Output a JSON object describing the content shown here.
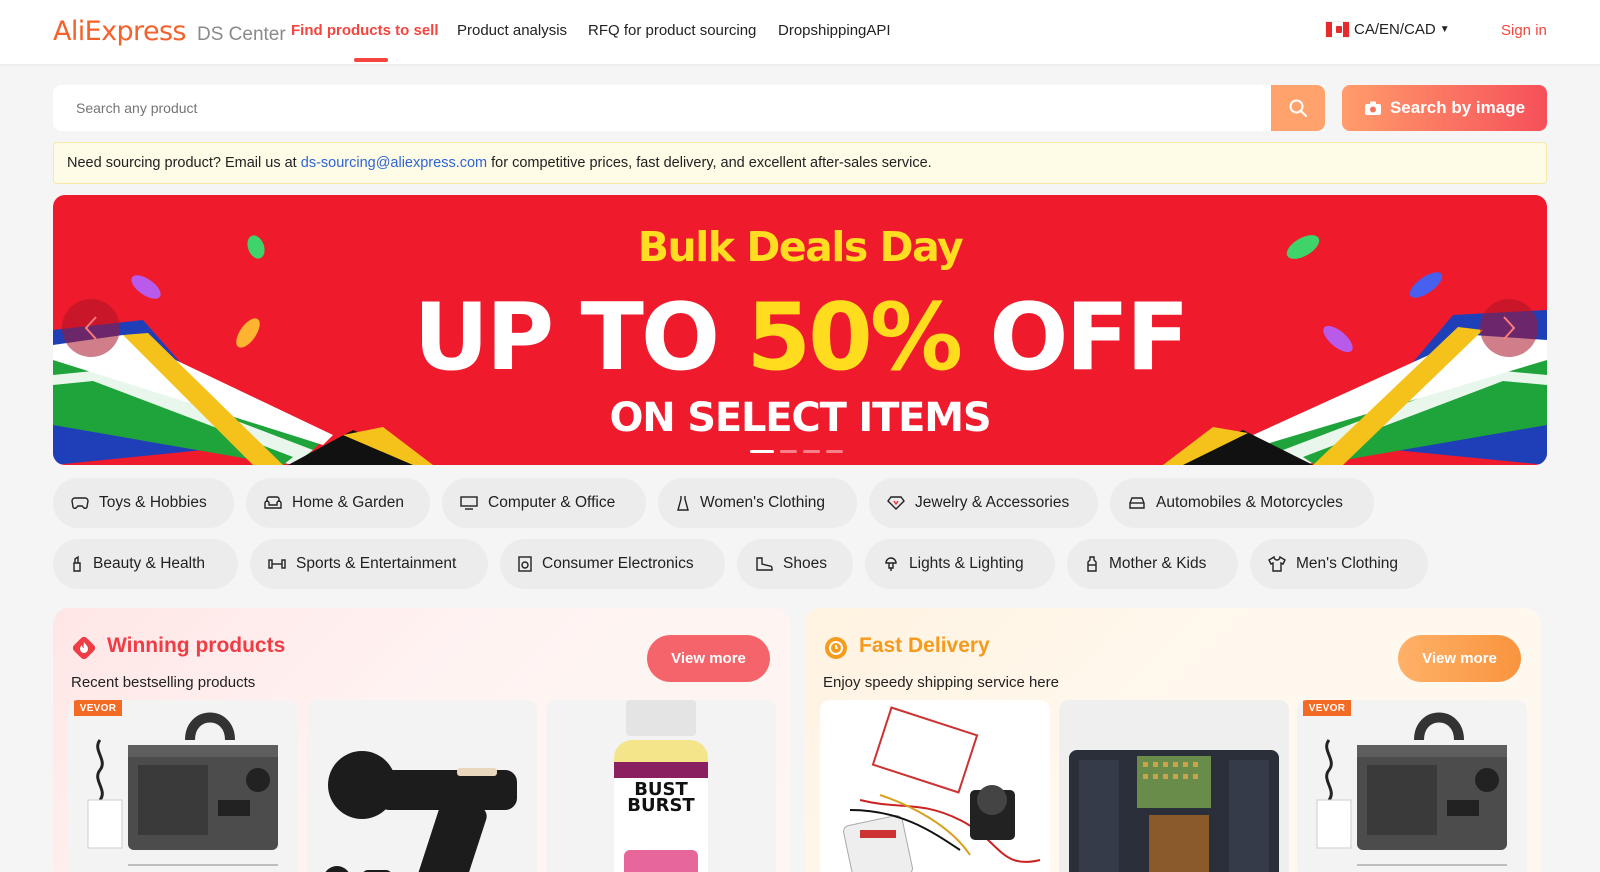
{
  "header": {
    "logo": "AliExpress",
    "logo_sub": "DS Center",
    "nav": [
      {
        "label": "Find products to sell",
        "active": true
      },
      {
        "label": "Product analysis"
      },
      {
        "label": "RFQ for product sourcing"
      },
      {
        "label": "DropshippingAPI"
      }
    ],
    "locale": "CA/EN/CAD",
    "sign_in": "Sign in"
  },
  "search": {
    "placeholder": "Search any product",
    "image_search_label": "Search by image"
  },
  "notice": {
    "prefix": "Need sourcing product? Email us at ",
    "email": "ds-sourcing@aliexpress.com",
    "suffix": " for competitive prices, fast delivery, and excellent after-sales service."
  },
  "banner": {
    "headline": "Bulk Deals Day",
    "main_prefix": "UP TO ",
    "main_highlight": "50%",
    "main_suffix": " OFF",
    "subline": "ON SELECT ITEMS",
    "slide_count": 4,
    "active_slide": 1
  },
  "categories_row1": [
    {
      "label": "Toys & Hobbies",
      "icon": "gamepad-icon"
    },
    {
      "label": "Home & Garden",
      "icon": "sofa-icon"
    },
    {
      "label": "Computer & Office",
      "icon": "monitor-icon"
    },
    {
      "label": "Women's Clothing",
      "icon": "dress-icon"
    },
    {
      "label": "Jewelry & Accessories",
      "icon": "diamond-icon"
    },
    {
      "label": "Automobiles & Motorcycles",
      "icon": "car-icon"
    }
  ],
  "categories_row2": [
    {
      "label": "Beauty & Health",
      "icon": "lipstick-icon"
    },
    {
      "label": "Sports & Entertainment",
      "icon": "dumbbell-icon"
    },
    {
      "label": "Consumer Electronics",
      "icon": "speaker-icon"
    },
    {
      "label": "Shoes",
      "icon": "shoe-icon"
    },
    {
      "label": "Lights & Lighting",
      "icon": "lamp-icon"
    },
    {
      "label": "Mother & Kids",
      "icon": "baby-bottle-icon"
    },
    {
      "label": "Men's Clothing",
      "icon": "tshirt-icon"
    }
  ],
  "cards": {
    "winning": {
      "title": "Winning products",
      "subtitle": "Recent bestselling products",
      "view_more": "View more",
      "products": [
        {
          "image": "ozone-generator",
          "brand_badge": "VEVOR"
        },
        {
          "image": "massage-gun"
        },
        {
          "image": "supplement-bottle",
          "label_lines": [
            "BUST",
            "BURST"
          ]
        }
      ]
    },
    "fast_delivery": {
      "title": "Fast Delivery",
      "subtitle": "Enjoy speedy shipping service here",
      "view_more": "View more",
      "products": [
        {
          "image": "brushless-motor-kit"
        },
        {
          "image": "printhead"
        },
        {
          "image": "ozone-generator",
          "brand_badge": "VEVOR"
        }
      ]
    }
  },
  "colors": {
    "accent_red": "#f5453f",
    "banner_red": "#ef1a2c",
    "banner_yellow": "#ffdc1e",
    "fast_orange": "#f59a1b"
  }
}
